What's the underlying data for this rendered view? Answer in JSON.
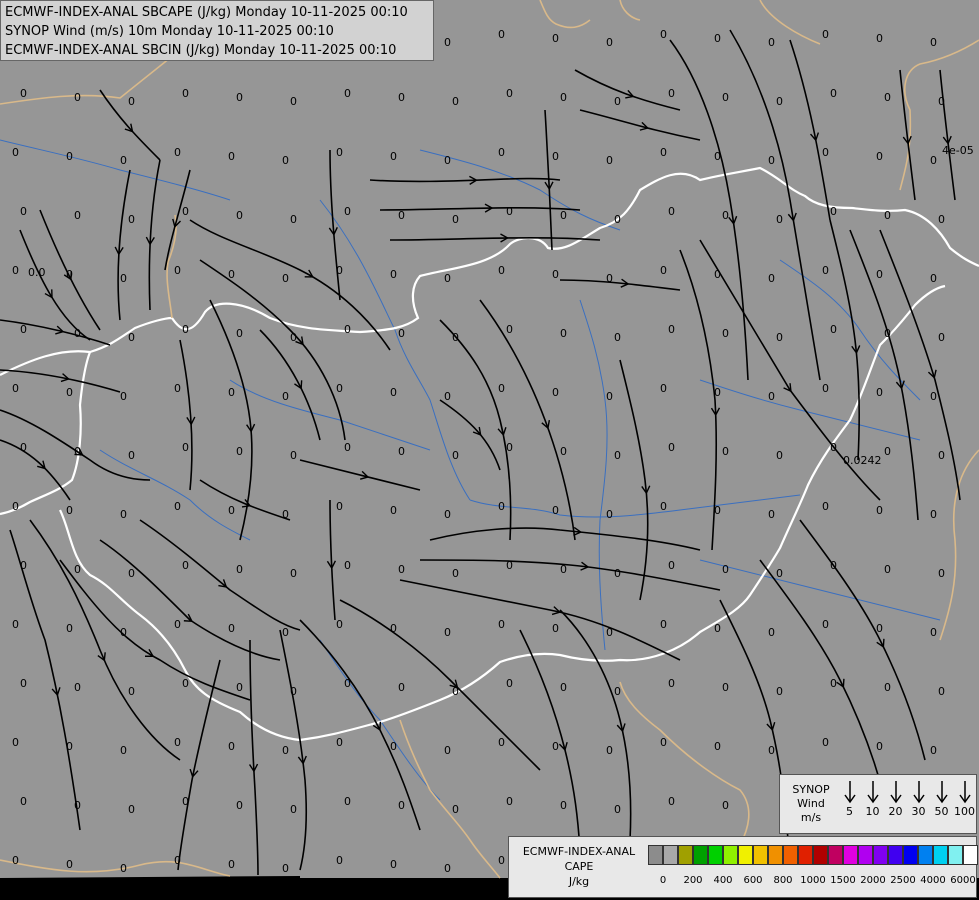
{
  "map_title": {
    "line1": "ECMWF-INDEX-ANAL SBCAPE (J/kg) Monday 10-11-2025 00:10",
    "line2": "SYNOP Wind (m/s) 10m Monday 10-11-2025 00:10",
    "line3": "ECMWF-INDEX-ANAL SBCIN (J/kg) Monday 10-11-2025 00:10"
  },
  "field_labels": {
    "zero": "0",
    "v1": "0.0242",
    "v2": "4e-05",
    "v3": "0.0"
  },
  "synop_legend": {
    "title1": "SYNOP",
    "title2": "Wind",
    "title3": "m/s",
    "speeds": [
      "5",
      "10",
      "20",
      "30",
      "50",
      "100"
    ]
  },
  "cape_legend": {
    "title1": "ECMWF-INDEX-ANAL",
    "title2": "CAPE",
    "title3": "J/kg",
    "labels": [
      "0",
      "200",
      "400",
      "600",
      "800",
      "1000",
      "1500",
      "2000",
      "2500",
      "4000",
      "6000"
    ],
    "colors": [
      "#8c8c8c",
      "#a8a8a8",
      "#a0a000",
      "#00a000",
      "#00d000",
      "#90f000",
      "#f0f000",
      "#f0c000",
      "#f09000",
      "#f06000",
      "#e02000",
      "#b00000",
      "#c00060",
      "#e000e0",
      "#b000f0",
      "#8000f0",
      "#4000f0",
      "#0000f0",
      "#0080f0",
      "#00d0f0",
      "#80f0f0",
      "#ffffff"
    ]
  },
  "colors": {
    "land": "#969696",
    "border_white": "#ffffff",
    "border_tan": "#d9b98a",
    "river": "#3a6fc0",
    "stream": "#000000"
  }
}
